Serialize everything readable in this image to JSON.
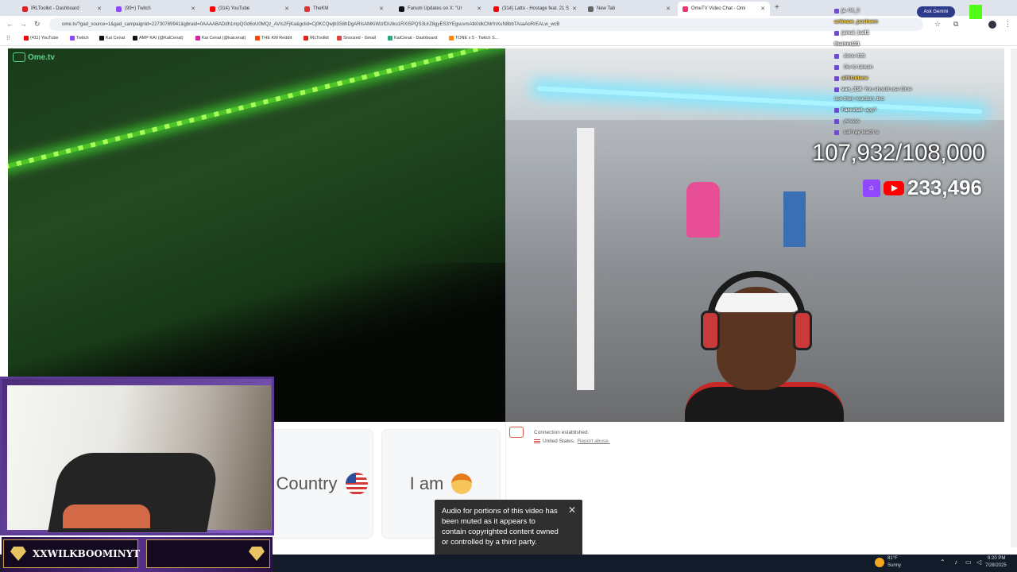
{
  "browser": {
    "tabs": [
      {
        "label": "IRLToolkit - Dashboard",
        "color": "#d22"
      },
      {
        "label": "(99+) Twitch",
        "color": "#9146ff"
      },
      {
        "label": "(314) YouTube",
        "color": "#f00"
      },
      {
        "label": "TheKM",
        "color": "#d33"
      },
      {
        "label": "Fanum Updates on X: \"Ur",
        "color": "#111"
      },
      {
        "label": "(314) Latto - Hostage feat. 21 S",
        "color": "#f00"
      },
      {
        "label": "New Tab",
        "color": "#666"
      },
      {
        "label": "OmeTV Video Chat - Omi",
        "color": "#e37"
      }
    ],
    "url": "ome.tv/?gad_source=1&gad_campaignid=22730789941&gbraid=0AAAABADdh1mpQGd6oU0MQz_AVIs2FjKa&gclid=Cj0KCQwjb3S8hDgARIsAMKiWzifDUIko1RXiSPQS3UrZ8gyES3YEgsuvmAtk0dkCMrfnXuN8bbTAsaAoRrEALw_wcB",
    "bookmarks": [
      {
        "label": "(411) YouTube",
        "color": "#f00"
      },
      {
        "label": "Twitch",
        "color": "#9146ff"
      },
      {
        "label": "Kai Cenat",
        "color": "#111"
      },
      {
        "label": "AMP KAI (@KaiCenat)",
        "color": "#111"
      },
      {
        "label": "Kai Cenat (@kaicenat)",
        "color": "#d6249f"
      },
      {
        "label": "THE KM Reddit",
        "color": "#ff4500"
      },
      {
        "label": "IRLToolkit",
        "color": "#d22"
      },
      {
        "label": "Snoozed - Gmail",
        "color": "#d44"
      },
      {
        "label": "KaiCenat - Dashboard",
        "color": "#2a7"
      },
      {
        "label": "TONE x 5 - Twitch S...",
        "color": "#f80"
      }
    ]
  },
  "omelogo": "Ome.tv",
  "chat_overlay": {
    "lines": [
      {
        "user": "ja",
        "text": "04_9"
      },
      {
        "user": "unknow_pusheen",
        "text": ""
      },
      {
        "user": "jamal_ball1",
        "text": ""
      },
      {
        "user": "thamm121",
        "text": ""
      },
      {
        "user": "",
        "text": "dooo ittttt"
      },
      {
        "user": "",
        "text": "Go to taiwan"
      },
      {
        "user": "allfdzidane",
        "text": ""
      },
      {
        "user": "van_338",
        "text": "You should use Ome"
      },
      {
        "user": "",
        "text": "see their reaction, bro"
      },
      {
        "user": "Farestall",
        "text": "app?"
      },
      {
        "user": "",
        "text": "yessss"
      },
      {
        "user": "",
        "text": "call ray teach u"
      }
    ],
    "ask_button": "Ask Gemini"
  },
  "stats": {
    "subs": "107,932/108,000",
    "viewers": "233,496"
  },
  "cards": {
    "country": "Country",
    "iam": "I am"
  },
  "connection": {
    "status": "Connection established.",
    "location": "United States.",
    "report": "Report abuse."
  },
  "toast": {
    "message": "Audio for portions of this video has been muted as it appears to contain copyrighted content owned or controlled by a third party.",
    "close": "✕"
  },
  "nameplate": "XXWILKBOOMINYT",
  "taskbar": {
    "weather_temp": "81°F",
    "weather_text": "Sunny",
    "time": "9:20 PM",
    "date": "7/28/2025"
  }
}
